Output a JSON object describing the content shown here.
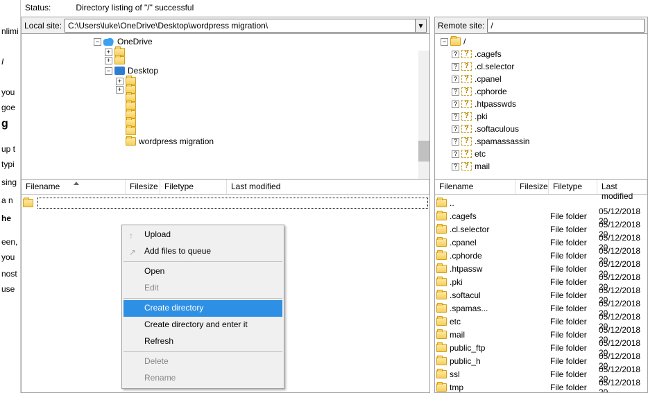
{
  "status": {
    "label": "Status:",
    "text": "Directory listing of \"/\" successful"
  },
  "local": {
    "label": "Local site:",
    "path": "C:\\Users\\luke\\OneDrive\\Desktop\\wordpress migration\\",
    "tree": {
      "onedrive": "OneDrive",
      "desktop": "Desktop",
      "wpm": "wordpress migration"
    }
  },
  "remote": {
    "label": "Remote site:",
    "path": "/",
    "tree_root": "/",
    "tree_items": [
      ".cagefs",
      ".cl.selector",
      ".cpanel",
      ".cphorde",
      ".htpasswds",
      ".pki",
      ".softaculous",
      ".spamassassin",
      "etc",
      "mail"
    ]
  },
  "columns": {
    "name": "Filename",
    "size": "Filesize",
    "type": "Filetype",
    "mod": "Last modified"
  },
  "local_list": {
    "parent": ".."
  },
  "remote_list": [
    {
      "name": "..",
      "type": "",
      "mod": ""
    },
    {
      "name": ".cagefs",
      "type": "File folder",
      "mod": "05/12/2018 20"
    },
    {
      "name": ".cl.selector",
      "type": "File folder",
      "mod": "05/12/2018 20"
    },
    {
      "name": ".cpanel",
      "type": "File folder",
      "mod": "05/12/2018 20"
    },
    {
      "name": ".cphorde",
      "type": "File folder",
      "mod": "05/12/2018 20"
    },
    {
      "name": ".htpassw",
      "type": "File folder",
      "mod": "05/12/2018 20"
    },
    {
      "name": ".pki",
      "type": "File folder",
      "mod": "05/12/2018 20"
    },
    {
      "name": ".softacul",
      "type": "File folder",
      "mod": "05/12/2018 20"
    },
    {
      "name": ".spamas...",
      "type": "File folder",
      "mod": "05/12/2018 20"
    },
    {
      "name": "etc",
      "type": "File folder",
      "mod": "05/12/2018 20"
    },
    {
      "name": "mail",
      "type": "File folder",
      "mod": "05/12/2018 20"
    },
    {
      "name": "public_ftp",
      "type": "File folder",
      "mod": "05/12/2018 20"
    },
    {
      "name": "public_h",
      "type": "File folder",
      "mod": "05/12/2018 20"
    },
    {
      "name": "ssl",
      "type": "File folder",
      "mod": "05/12/2018 20"
    },
    {
      "name": "tmp",
      "type": "File folder",
      "mod": "05/12/2018 20"
    }
  ],
  "ctx": {
    "upload": "Upload",
    "addq": "Add files to queue",
    "open": "Open",
    "edit": "Edit",
    "createdir": "Create directory",
    "createdirenter": "Create directory and enter it",
    "refresh": "Refresh",
    "delete": "Delete",
    "rename": "Rename"
  },
  "left_fragments": [
    "nlimi",
    " you",
    " goe",
    "g",
    " up t",
    " typi",
    "sing",
    " a n",
    " he",
    "een,",
    "you",
    "nost",
    "use"
  ]
}
